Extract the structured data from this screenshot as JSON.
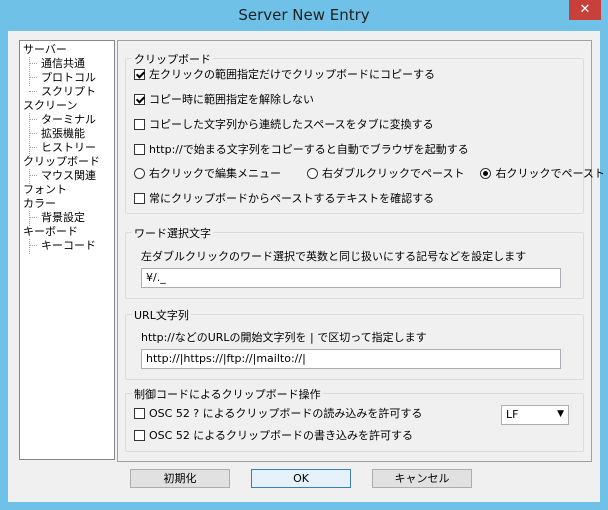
{
  "window": {
    "title": "Server New Entry",
    "close_label": "✕"
  },
  "tree": {
    "items": [
      {
        "label": "サーバー",
        "level": 0
      },
      {
        "label": "通信共通",
        "level": 1
      },
      {
        "label": "プロトコル",
        "level": 1
      },
      {
        "label": "スクリプト",
        "level": 1
      },
      {
        "label": "スクリーン",
        "level": 0
      },
      {
        "label": "ターミナル",
        "level": 1
      },
      {
        "label": "拡張機能",
        "level": 1
      },
      {
        "label": "ヒストリー",
        "level": 1
      },
      {
        "label": "クリップボード",
        "level": 0
      },
      {
        "label": "マウス関連",
        "level": 1
      },
      {
        "label": "フォント",
        "level": 0
      },
      {
        "label": "カラー",
        "level": 0
      },
      {
        "label": "背景設定",
        "level": 1
      },
      {
        "label": "キーボード",
        "level": 0
      },
      {
        "label": "キーコード",
        "level": 1
      }
    ]
  },
  "clipboard": {
    "title": "クリップボード",
    "options": [
      {
        "label": "左クリックの範囲指定だけでクリップボードにコピーする",
        "checked": true
      },
      {
        "label": "コピー時に範囲指定を解除しない",
        "checked": true
      },
      {
        "label": "コピーした文字列から連続したスペースをタブに変換する",
        "checked": false
      },
      {
        "label": "http://で始まる文字列をコピーすると自動でブラウザを起動する",
        "checked": false
      }
    ],
    "radios": [
      {
        "label": "右クリックで編集メニュー",
        "checked": false
      },
      {
        "label": "右ダブルクリックでペースト",
        "checked": false
      },
      {
        "label": "右クリックでペースト",
        "checked": true
      }
    ],
    "confirm": {
      "label": "常にクリップボードからペーストするテキストを確認する",
      "checked": false
    }
  },
  "word_select": {
    "title": "ワード選択文字",
    "description": "左ダブルクリックのワード選択で英数と同じ扱いにする記号などを設定します",
    "value": "¥/._"
  },
  "url_chars": {
    "title": "URL文字列",
    "description": "http://などのURLの開始文字列を | で区切って指定します",
    "value": "http://|https://|ftp://|mailto://|"
  },
  "control_code": {
    "title": "制御コードによるクリップボード操作",
    "read": {
      "label": "OSC 52 ? によるクリップボードの読み込みを許可する",
      "checked": false
    },
    "write": {
      "label": "OSC 52 によるクリップボードの書き込みを許可する",
      "checked": false
    },
    "newline_select": "LF"
  },
  "buttons": {
    "init": "初期化",
    "ok": "OK",
    "cancel": "キャンセル"
  }
}
